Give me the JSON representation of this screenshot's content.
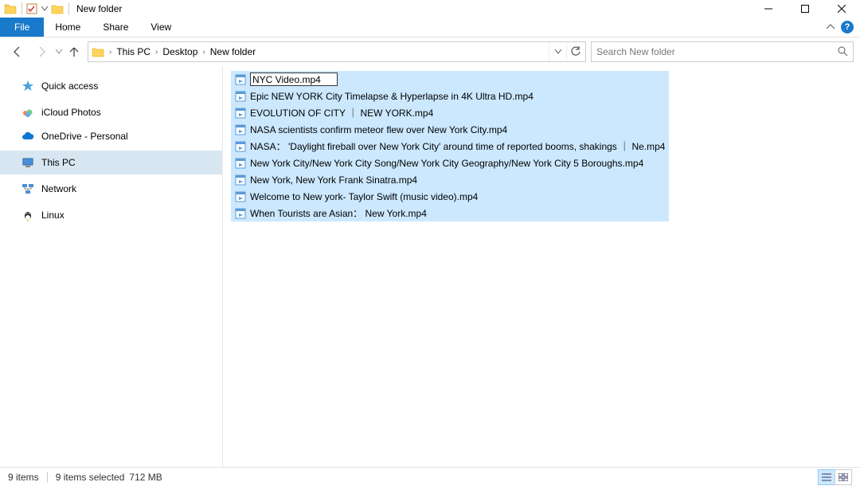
{
  "window": {
    "title": "New folder"
  },
  "ribbon": {
    "file": "File",
    "home": "Home",
    "share": "Share",
    "view": "View"
  },
  "breadcrumbs": {
    "items": [
      "This PC",
      "Desktop",
      "New folder"
    ]
  },
  "search": {
    "placeholder": "Search New folder"
  },
  "sidebar": {
    "items": [
      {
        "label": "Quick access",
        "icon": "star"
      },
      {
        "label": "iCloud Photos",
        "icon": "icloud"
      },
      {
        "label": "OneDrive - Personal",
        "icon": "cloud"
      },
      {
        "label": "This PC",
        "icon": "pc",
        "selected": true
      },
      {
        "label": "Network",
        "icon": "network"
      },
      {
        "label": "Linux",
        "icon": "linux"
      }
    ]
  },
  "files": [
    {
      "name": "NYC Video.mp4",
      "renaming": true
    },
    {
      "name": "Epic NEW YORK City Timelapse & Hyperlapse in 4K Ultra HD.mp4"
    },
    {
      "name": "EVOLUTION OF CITY ｜ NEW YORK.mp4"
    },
    {
      "name": "NASA scientists confirm meteor flew over New York City.mp4"
    },
    {
      "name": "NASA： 'Daylight fireball over New York City' around time of reported booms, shakings ｜ Ne.mp4"
    },
    {
      "name": "New York City/New York City Song/New York City Geography/New York City 5 Boroughs.mp4"
    },
    {
      "name": "New York, New York Frank Sinatra.mp4"
    },
    {
      "name": "Welcome to New york- Taylor Swift (music video).mp4"
    },
    {
      "name": "When Tourists are Asian： New York.mp4"
    }
  ],
  "status": {
    "count": "9 items",
    "selection": "9 items selected",
    "size": "712 MB"
  }
}
